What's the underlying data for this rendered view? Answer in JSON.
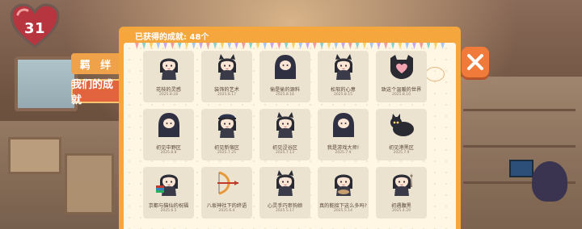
{
  "hud": {
    "heart_value": "31"
  },
  "tabs": [
    {
      "label": "羁 绊"
    },
    {
      "label": "我们的成就"
    }
  ],
  "panel": {
    "title": "已获得的成就: 48个"
  },
  "achievements": [
    {
      "title": "花枝的灵感",
      "date": "2025.8.18",
      "icon": "girl-sitting"
    },
    {
      "title": "装饰的艺术",
      "date": "2025.8.17",
      "icon": "catgirl-hands"
    },
    {
      "title": "偷是偷的源料",
      "date": "2025.8.16",
      "icon": "hooded-figure"
    },
    {
      "title": "松软的心意",
      "date": "2025.8.15",
      "icon": "catgirl-face"
    },
    {
      "title": "致这个温暖的世界",
      "date": "2025.8.10",
      "icon": "heart-cat"
    },
    {
      "title": "初见中野区",
      "date": "2025.8.8",
      "icon": "cloaked-girl"
    },
    {
      "title": "初见新宿区",
      "date": "2025.7.25",
      "icon": "police-cap-girl"
    },
    {
      "title": "初见涩谷区",
      "date": "2025.7.13",
      "icon": "catgirl-peace"
    },
    {
      "title": "我是游戏大师!",
      "date": "2025.7.9",
      "icon": "ninja-pose"
    },
    {
      "title": "初见港黑区",
      "date": "2025.7.9",
      "icon": "black-cat"
    },
    {
      "title": "京都与猫仙的祝福",
      "date": "2025.6.5",
      "icon": "books-girl"
    },
    {
      "title": "八坂神社下的终语",
      "date": "2025.6.4",
      "icon": "bow-arrow"
    },
    {
      "title": "心灵手巧串钩娘",
      "date": "2025.5.17",
      "icon": "catgirl-wave"
    },
    {
      "title": "真的能接下这么多吗?",
      "date": "2025.5.14",
      "icon": "girl-bowl"
    },
    {
      "title": "初遇腹黑",
      "date": "2025.4.29",
      "icon": "tower-girl"
    }
  ],
  "colors": {
    "panel": "#f5a63d",
    "card": "#ece2d0",
    "close": "#f07a3a",
    "tab_active": "#e2643f",
    "tab": "#f0a24b"
  }
}
